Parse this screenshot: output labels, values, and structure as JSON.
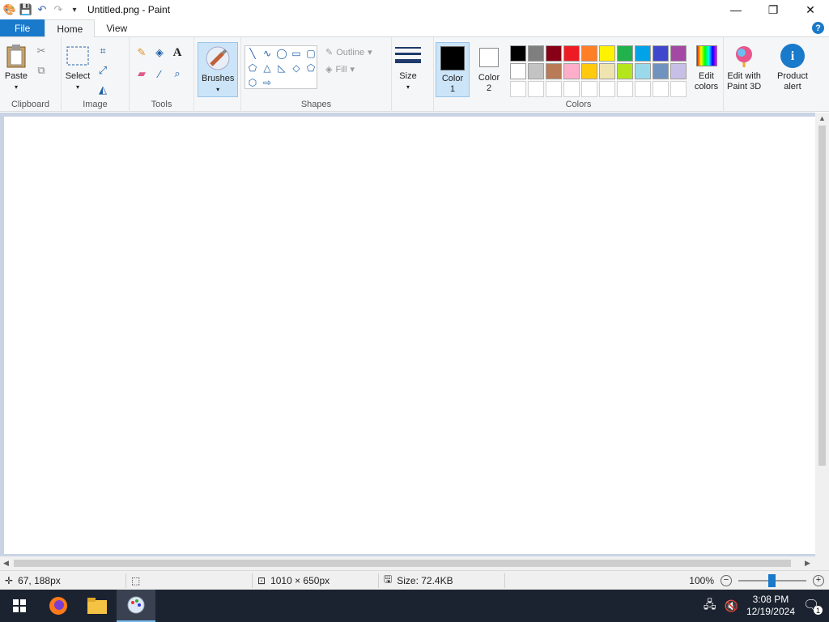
{
  "titlebar": {
    "title": "Untitled.png - Paint"
  },
  "tabs": {
    "file": "File",
    "home": "Home",
    "view": "View",
    "help": "?"
  },
  "clipboard": {
    "paste": "Paste",
    "label": "Clipboard"
  },
  "image": {
    "select": "Select",
    "label": "Image"
  },
  "tools": {
    "label": "Tools",
    "text_tool": "A"
  },
  "brushes": {
    "label": "Brushes"
  },
  "shapes": {
    "outline": "Outline",
    "fill": "Fill",
    "label": "Shapes"
  },
  "size": {
    "label": "Size"
  },
  "colors": {
    "color1_label": "Color",
    "color1_num": "1",
    "color2_label": "Color",
    "color2_num": "2",
    "edit_colors_1": "Edit",
    "edit_colors_2": "colors",
    "label": "Colors",
    "color1_value": "#000000",
    "color2_value": "#ffffff",
    "palette_row1": [
      "#000000",
      "#7f7f7f",
      "#880015",
      "#ed1c24",
      "#ff7f27",
      "#fff200",
      "#22b14c",
      "#00a2e8",
      "#3f48cc",
      "#a349a4"
    ],
    "palette_row2": [
      "#ffffff",
      "#c3c3c3",
      "#b97a57",
      "#ffaec9",
      "#ffc90e",
      "#efe4b0",
      "#b5e61d",
      "#99d9ea",
      "#7092be",
      "#c8bfe7"
    ]
  },
  "paint3d": {
    "line1": "Edit with",
    "line2": "Paint 3D"
  },
  "product_alert": {
    "line1": "Product",
    "line2": "alert"
  },
  "statusbar": {
    "cursor_pos": "67, 188px",
    "dimensions": "1010 × 650px",
    "size": "Size: 72.4KB",
    "zoom": "100%"
  },
  "taskbar": {
    "time": "3:08 PM",
    "date": "12/19/2024",
    "notification_count": "1"
  }
}
